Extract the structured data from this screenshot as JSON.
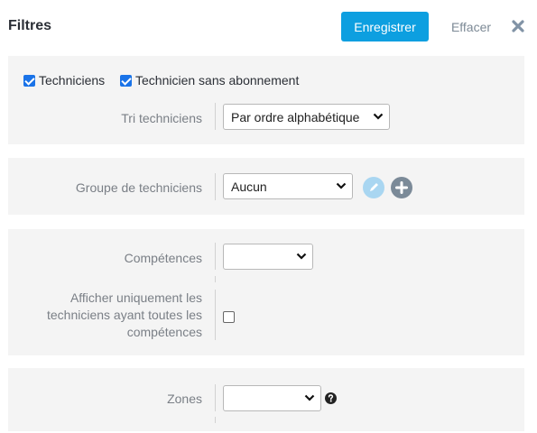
{
  "header": {
    "title": "Filtres",
    "save_label": "Enregistrer",
    "clear_label": "Effacer",
    "close_icon": "close-icon"
  },
  "colors": {
    "accent": "#0d9fe0",
    "panel_bg": "#f4f4f4",
    "muted_text": "#7a7f86",
    "edit_button": "#a9d6f1",
    "add_button": "#7b8a98"
  },
  "technicians": {
    "checkbox_technicians_label": "Techniciens",
    "checkbox_technicians_checked": true,
    "checkbox_no_subscription_label": "Technicien sans abonnement",
    "checkbox_no_subscription_checked": true,
    "sort_label": "Tri techniciens",
    "sort_value": "Par ordre alphabétique"
  },
  "group": {
    "label": "Groupe de techniciens",
    "value": "Aucun",
    "edit_icon": "pencil-icon",
    "add_icon": "plus-icon"
  },
  "skills": {
    "label": "Compétences",
    "value": "",
    "only_all_label": "Afficher uniquement les techniciens ayant toutes les compétences",
    "only_all_line1": "Afficher uniquement les",
    "only_all_line2": "techniciens ayant toutes les",
    "only_all_line3": "compétences",
    "only_all_checked": false
  },
  "zones": {
    "label": "Zones",
    "value": "",
    "help_icon": "question-circle-icon"
  }
}
